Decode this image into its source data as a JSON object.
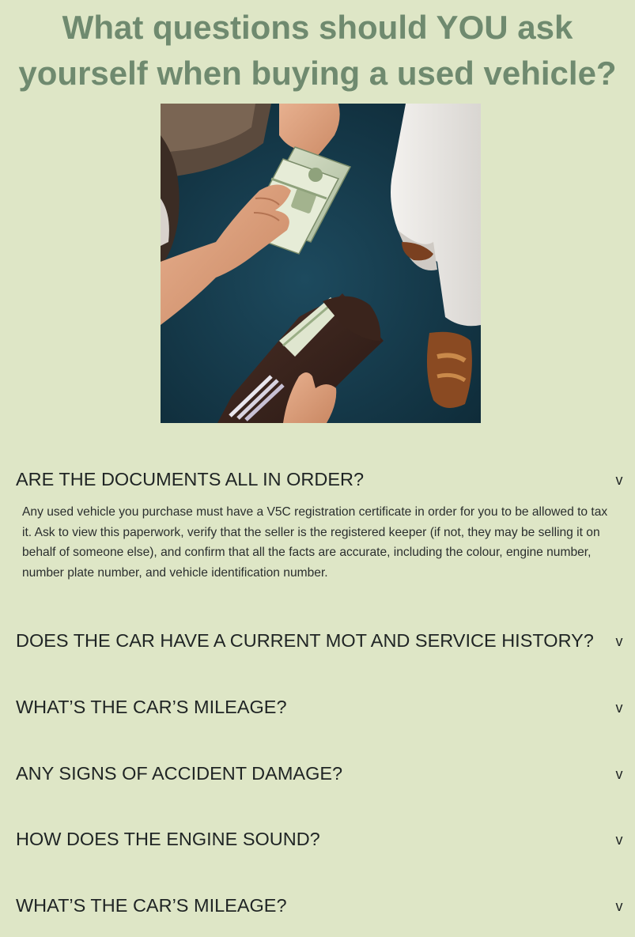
{
  "page": {
    "title": "What questions should YOU ask yourself when buying a used vehicle?",
    "title_color": "#6f8a6f",
    "background_color": "#dee6c6"
  },
  "hero_image": {
    "description_icon": "cash-payment-photo-icon"
  },
  "faq": [
    {
      "question": "ARE THE DOCUMENTS ALL IN ORDER?",
      "toggle": "v",
      "expanded": true,
      "answer": "Any used vehicle you purchase must have a V5C registration certificate in order for you to be allowed to tax it. Ask to view this paperwork, verify that the seller is the registered keeper (if not, they may be selling it on behalf of someone else), and confirm that all the facts are accurate, including the colour, engine number, number plate number, and vehicle identification number."
    },
    {
      "question": "DOES THE CAR HAVE A CURRENT MOT AND SERVICE HISTORY?",
      "toggle": "v",
      "expanded": false
    },
    {
      "question": "WHAT’S THE CAR’S MILEAGE?",
      "toggle": "v",
      "expanded": false
    },
    {
      "question": "ANY SIGNS OF ACCIDENT DAMAGE?",
      "toggle": "v",
      "expanded": false
    },
    {
      "question": "HOW DOES THE ENGINE SOUND?",
      "toggle": "v",
      "expanded": false
    },
    {
      "question": "WHAT’S THE CAR’S MILEAGE?",
      "toggle": "v",
      "expanded": false
    }
  ]
}
